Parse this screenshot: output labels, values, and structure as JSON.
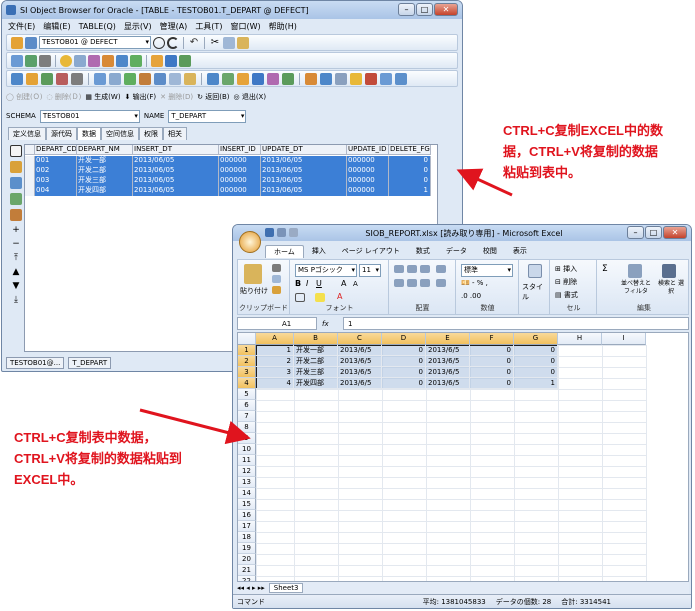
{
  "browser": {
    "title": "SI Object Browser for Oracle - [TABLE - TESTOB01.T_DEPART @ DEFECT]",
    "menu": [
      "文件(E)",
      "编辑(E)",
      "TABLE(Q)",
      "显示(V)",
      "管理(A)",
      "工具(T)",
      "窗口(W)",
      "帮助(H)"
    ],
    "connection": "TESTOB01 @ DEFECT",
    "actions": {
      "create": "创建(Ｏ)",
      "drop": "删除(Ｄ)",
      "generate": "生成(W)",
      "export": "输出(F)",
      "remove": "删除(D)",
      "back": "返回(B)",
      "exit": "退出(X)"
    },
    "schema_label": "SCHEMA",
    "schema_value": "TESTOB01",
    "name_label": "NAME",
    "name_value": "T_DEPART",
    "tabs": [
      "定义信息",
      "源代码",
      "数据",
      "空间信息",
      "权限",
      "相关"
    ],
    "active_tab": "数据",
    "columns": [
      "DEPART_CD",
      "DEPART_NM",
      "INSERT_DT",
      "INSERT_ID",
      "UPDATE_DT",
      "UPDATE_ID",
      "DELETE_FG"
    ],
    "rows": [
      [
        "001",
        "开发一部",
        "2013/06/05",
        "000000",
        "2013/06/05",
        "000000",
        "0"
      ],
      [
        "002",
        "开发二部",
        "2013/06/05",
        "000000",
        "2013/06/05",
        "000000",
        "0"
      ],
      [
        "003",
        "开发三部",
        "2013/06/05",
        "000000",
        "2013/06/05",
        "000000",
        "0"
      ],
      [
        "004",
        "开发四部",
        "2013/06/05",
        "000000",
        "2013/06/05",
        "000000",
        "1"
      ]
    ],
    "bottom_tabs": [
      "TESTOB01@...",
      "T_DEPART"
    ]
  },
  "excel": {
    "title": "SIOB_REPORT.xlsx [読み取り専用] - Microsoft Excel",
    "ribbon_tabs": [
      "ホーム",
      "挿入",
      "ページ レイアウト",
      "数式",
      "データ",
      "校閲",
      "表示"
    ],
    "active_ribbon_tab": "ホーム",
    "paste_label": "貼り付け",
    "font_name": "MS Pゴシック",
    "font_size": "11",
    "number_format": "標準",
    "style_label": "スタイル",
    "insert_label": "挿入",
    "delete_label": "削除",
    "format_label": "書式",
    "sort_label": "並べ替えと フィルタ",
    "find_label": "検索と 選択",
    "group_names": [
      "クリップボード",
      "フォント",
      "配置",
      "数値",
      "セル",
      "編集"
    ],
    "name_box": "A1",
    "formula_value": "1",
    "column_headers": [
      "A",
      "B",
      "C",
      "D",
      "E",
      "F",
      "G",
      "H",
      "I"
    ],
    "row_numbers": [
      "1",
      "2",
      "3",
      "4",
      "5",
      "6",
      "7",
      "8",
      "9",
      "10",
      "11",
      "12",
      "13",
      "14",
      "15",
      "16",
      "17",
      "18",
      "19",
      "20",
      "21",
      "22"
    ],
    "cells": [
      [
        "1",
        "开发一部",
        "2013/6/5",
        "0",
        "2013/6/5",
        "0",
        "0"
      ],
      [
        "2",
        "开发二部",
        "2013/6/5",
        "0",
        "2013/6/5",
        "0",
        "0"
      ],
      [
        "3",
        "开发三部",
        "2013/6/5",
        "0",
        "2013/6/5",
        "0",
        "0"
      ],
      [
        "4",
        "开发四部",
        "2013/6/5",
        "0",
        "2013/6/5",
        "0",
        "1"
      ]
    ],
    "sheet_tab": "Sheet3",
    "status_mode": "コマンド",
    "status_avg": "平均: 1381045833",
    "status_count": "データの個数: 28",
    "status_sum": "合計: 3314541"
  },
  "notes": {
    "top_right": [
      "CTRL+C复制EXCEL中的数",
      "据，CTRL+V将复制的数据",
      "粘贴到表中。"
    ],
    "bottom_left": [
      "CTRL+C复制表中数据，",
      "CTRL+V将复制的数据粘贴到",
      "EXCEL中。"
    ],
    "color": "#e0141e"
  }
}
